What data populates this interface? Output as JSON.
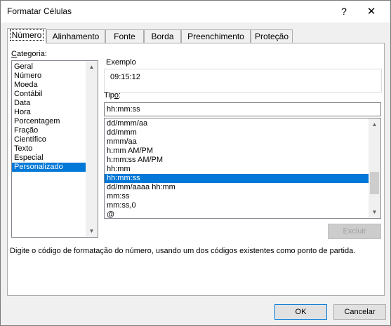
{
  "window": {
    "title": "Formatar Células",
    "help": "?",
    "close": "✕"
  },
  "tabs": [
    {
      "label": "Número"
    },
    {
      "label": "Alinhamento"
    },
    {
      "label": "Fonte"
    },
    {
      "label": "Borda"
    },
    {
      "label": "Preenchimento"
    },
    {
      "label": "Proteção"
    }
  ],
  "categoria": {
    "label_prefix": "C",
    "label_rest": "ategoria:",
    "items": [
      "Geral",
      "Número",
      "Moeda",
      "Contábil",
      "Data",
      "Hora",
      "Porcentagem",
      "Fração",
      "Científico",
      "Texto",
      "Especial",
      "Personalizado"
    ],
    "selected": "Personalizado"
  },
  "exemplo": {
    "label": "Exemplo",
    "value": "09:15:12"
  },
  "tipo": {
    "label_prefix": "Tip",
    "label_u": "o",
    "label_suffix": ":",
    "value": "hh:mm:ss",
    "items": [
      "dd/mmm/aa",
      "dd/mmm",
      "mmm/aa",
      "h:mm AM/PM",
      "h:mm:ss AM/PM",
      "hh:mm",
      "hh:mm:ss",
      "dd/mm/aaaa hh:mm",
      "mm:ss",
      "mm:ss,0",
      "@"
    ],
    "selected": "hh:mm:ss"
  },
  "buttons": {
    "excluir": "Excluir",
    "ok": "OK",
    "cancelar": "Cancelar"
  },
  "description": "Digite o código de formatação do número, usando um dos códigos existentes como ponto de partida.",
  "colors": {
    "selection": "#0078d7",
    "dialog_bg": "#f0f0f0"
  }
}
